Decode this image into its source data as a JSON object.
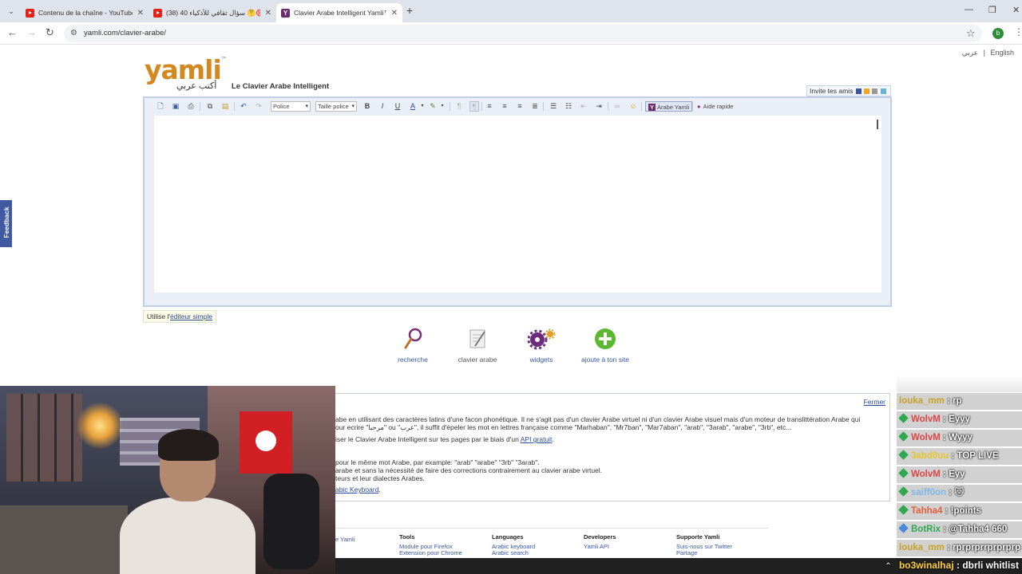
{
  "browser": {
    "tabs": [
      {
        "title": "Contenu de la chaîne - YouTube",
        "favicon": "youtube-icon",
        "active": false
      },
      {
        "title": "(38) 40 سؤال ثقافي للأذكياء 🤔🎯",
        "favicon": "youtube-icon",
        "active": false
      },
      {
        "title": "Clavier Arabe Intelligent Yamli™",
        "favicon": "yamli-icon",
        "active": true
      }
    ],
    "new_tab": "+",
    "url": "yamli.com/clavier-arabe/",
    "profile_initial": "b"
  },
  "page": {
    "lang_links": [
      "عربي",
      "|",
      "English"
    ],
    "logo": {
      "word": "yamli",
      "tm": "™",
      "arabic": "أكتب عربي"
    },
    "tagline": "Le Clavier Arabe Intelligent",
    "invite": "Invite tes amis",
    "toolbar": {
      "font_select": "Police",
      "size_select": "Taille police",
      "bold": "B",
      "italic": "I",
      "underline": "U",
      "font_color": "A",
      "yamli_button": "Arabe Yamli",
      "help_button": "Aide rapide"
    },
    "simple_editor": {
      "prefix": "Utilise l'",
      "link": "éditeur simple"
    },
    "feedback": "Feedback",
    "features": [
      {
        "label": "recherche",
        "icon": "magnifier-icon"
      },
      {
        "label": "clavier arabe",
        "icon": "notepad-icon"
      },
      {
        "label": "widgets",
        "icon": "gears-icon"
      },
      {
        "label": "ajoute à ton site",
        "icon": "plus-icon"
      }
    ],
    "info": {
      "close": "Fermer",
      "line1": "abe en utilisant des caractères latins d'une facon phonétique. Il ne s'agit pas d'un clavier Arabe virtuel ni d'un clavier Arabe visuel mais d'un moteur de translittération Arabe qui",
      "line2": "our ecrire \"مرحبا\" ou \"عرب\", il suffit d'épeler les mot en lettres française comme \"Marhaban\", \"Mr7ban\", \"Mar7aban\", \"arab\", \"3arab\", \"arabe\", \"3rb\", etc...",
      "line3_prefix": "iser le Clavier Arabe Intelligent sur tes pages par le biais d'un ",
      "line3_link": "API gratuit",
      "line3_suffix": ".",
      "line4": " pour le même mot Arabe, par example: \"arab\" \"arabe\" \"3rb\" \"3arab\".",
      "line5": " arabe et sans la nécessité de faire des corrections contrairement au clavier arabe virtuel.",
      "line6": "teurs et leur dialectes Arabes.",
      "line7_link": "abic Keyboard",
      "line7_suffix": "."
    },
    "footer": [
      {
        "heading": "",
        "links": [
          "e Yamli"
        ]
      },
      {
        "heading": "Tools",
        "links": [
          "Module pour Firefox",
          "Extension pour Chrome"
        ]
      },
      {
        "heading": "Languages",
        "links": [
          "Arabic keyboard",
          "Arabic search"
        ]
      },
      {
        "heading": "Developers",
        "links": [
          "Yamli API"
        ]
      },
      {
        "heading": "Supporte Yamli",
        "links": [
          "Suis-nous sur Twitter",
          "Partage"
        ]
      }
    ]
  },
  "chat": [
    {
      "user": "louka_mm",
      "msg": "rp",
      "badge": false
    },
    {
      "user": "WolvM",
      "msg": "Eyyy",
      "badge": true
    },
    {
      "user": "WolvM",
      "msg": "Wyyy",
      "badge": true
    },
    {
      "user": "3abd0uu",
      "msg": "TOP LIVE",
      "badge": true
    },
    {
      "user": "WolvM",
      "msg": "Eyy",
      "badge": true
    },
    {
      "user": "saiff0on",
      "msg": "🐱",
      "badge": true
    },
    {
      "user": "Tahha4",
      "msg": "!points",
      "badge": true
    },
    {
      "user": "BotRix",
      "msg": "@Tahha4 660",
      "badge": true
    },
    {
      "user": "louka_mm",
      "msg": "rprprprrprprprp",
      "badge": false
    }
  ],
  "taskbar": {
    "user": "bo3winalhaj",
    "msg": "dbrli whitlist"
  }
}
